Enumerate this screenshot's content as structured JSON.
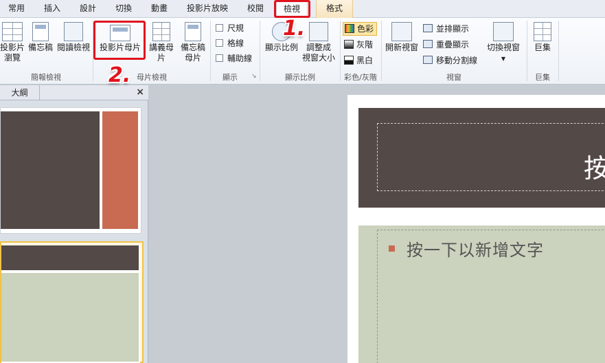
{
  "tabs": [
    "常用",
    "插入",
    "設計",
    "切換",
    "動畫",
    "投影片放映",
    "校閱",
    "檢視",
    "格式"
  ],
  "active_tab": "檢視",
  "ribbon": {
    "groups": {
      "presentation_views": "簡報檢視",
      "master_views": "母片檢視",
      "show": "顯示",
      "zoom": "顯示比例",
      "color_grayscale": "彩色/灰階",
      "window": "視窗",
      "macros": "巨集"
    },
    "buttons": {
      "slide_sorter_1": "投影片",
      "slide_sorter_2": "瀏覽",
      "notes_page": "備忘稿",
      "reading_view": "閱讀檢視",
      "slide_master": "投影片母片",
      "handout_master": "講義母片",
      "notes_master_1": "備忘稿",
      "notes_master_2": "母片",
      "ruler": "尺規",
      "gridlines": "格線",
      "guides": "輔助線",
      "zoom": "顯示比例",
      "fit_1": "調整成",
      "fit_2": "視窗大小",
      "color": "色彩",
      "grayscale": "灰階",
      "black_white": "黑白",
      "new_window": "開新視窗",
      "arrange_all": "並排顯示",
      "cascade": "重疊顯示",
      "move_split": "移動分割線",
      "switch_windows": "切換視窗",
      "macros": "巨集"
    }
  },
  "annotations": {
    "step1": "1.",
    "step2": "2."
  },
  "left_panel": {
    "tab_outline": "大綱",
    "close": "×"
  },
  "slide": {
    "title_text": "按",
    "body_text": "按一下以新增文字"
  },
  "colors": {
    "accent_red": "#e0141e",
    "slide_dark": "#534947",
    "slide_accent": "#c86b52",
    "slide_sage": "#cbd2bd"
  }
}
